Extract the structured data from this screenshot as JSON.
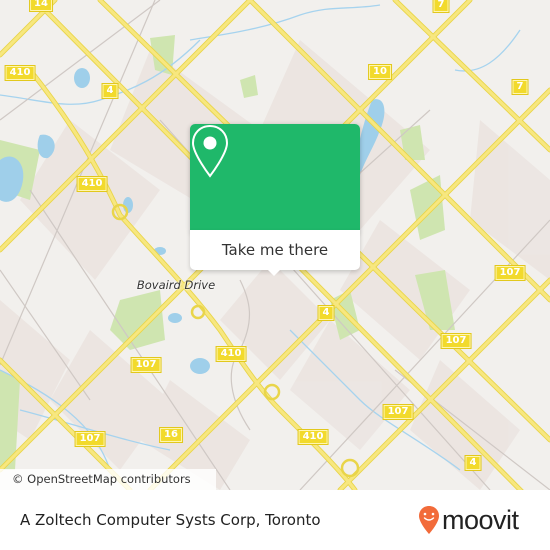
{
  "map": {
    "attribution": "© OpenStreetMap contributors",
    "place_labels": [
      {
        "id": "bovaird-drive",
        "text": "Bovaird Drive"
      }
    ],
    "route_shields": [
      {
        "id": "shield-14",
        "text": "14"
      },
      {
        "id": "shield-410-a",
        "text": "410"
      },
      {
        "id": "shield-4-a",
        "text": "4"
      },
      {
        "id": "shield-410-b",
        "text": "410"
      },
      {
        "id": "shield-10",
        "text": "10"
      },
      {
        "id": "shield-7-a",
        "text": "7"
      },
      {
        "id": "shield-7-b",
        "text": "7"
      },
      {
        "id": "shield-4-b",
        "text": "4"
      },
      {
        "id": "shield-107-a",
        "text": "107"
      },
      {
        "id": "shield-107-b",
        "text": "107"
      },
      {
        "id": "shield-107-c",
        "text": "107"
      },
      {
        "id": "shield-410-c",
        "text": "410"
      },
      {
        "id": "shield-107-d",
        "text": "107"
      },
      {
        "id": "shield-107-e",
        "text": "107"
      },
      {
        "id": "shield-16",
        "text": "16"
      },
      {
        "id": "shield-410-d",
        "text": "410"
      },
      {
        "id": "shield-410-e",
        "text": "410"
      },
      {
        "id": "shield-4-c",
        "text": "4"
      }
    ],
    "colors": {
      "land": "#f2f0ed",
      "road_major": "#f6e36a",
      "water": "#9fcfea",
      "park": "#cfe5b0",
      "popup_green": "#1fb86a"
    }
  },
  "popup": {
    "icon": "location-pin-icon",
    "button_label": "Take me there"
  },
  "footer": {
    "place_title": "A Zoltech Computer Systs Corp, Toronto",
    "brand": "moovit",
    "brand_color": "#f26b3a"
  }
}
